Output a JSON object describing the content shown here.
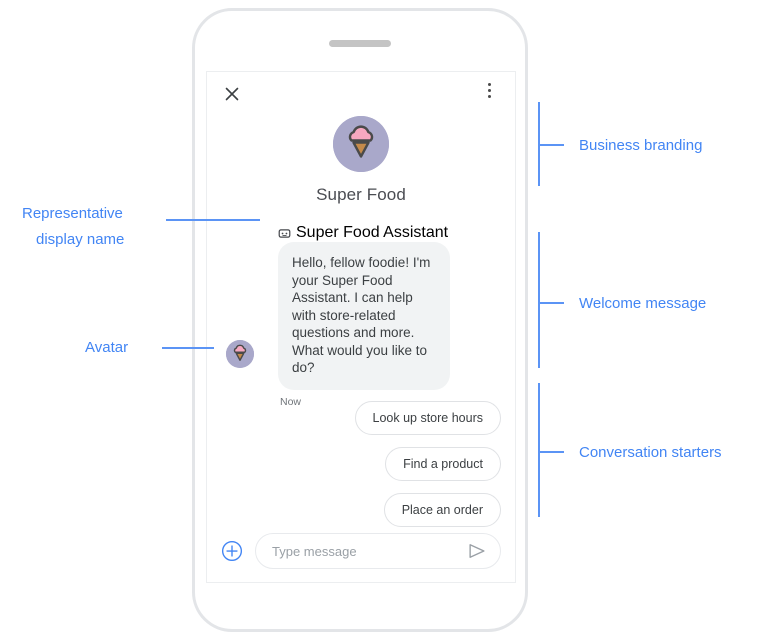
{
  "phone": {
    "speaker_grille": "speaker-grille"
  },
  "chat": {
    "topbar": {
      "close_label": "Close",
      "menu_label": "More options"
    },
    "branding": {
      "business_name": "Super Food",
      "avatar_icon": "ice-cream-cone-icon",
      "avatar_circle_color": "#a9a8ca",
      "scoop_color": "#f7a8c0",
      "cone_color": "#c58a4a",
      "outline_color": "#4a4a4a"
    },
    "representative": {
      "icon": "smart-toy-icon",
      "display_name": "Super Food Assistant"
    },
    "welcome_message": {
      "text": "Hello, fellow foodie! I'm your Super Food Assistant. I can help with store-related questions and more. What would you like to do?",
      "timestamp": "Now",
      "avatar_icon": "ice-cream-cone-icon"
    },
    "conversation_starters": [
      {
        "label": "Look up store hours"
      },
      {
        "label": "Find a product"
      },
      {
        "label": "Place an order"
      }
    ],
    "composer": {
      "add_icon": "plus-circle-icon",
      "placeholder": "Type message",
      "value": "",
      "send_icon": "send-icon"
    }
  },
  "annotations": {
    "accent_color": "#4285f4",
    "right": [
      {
        "label": "Business branding"
      },
      {
        "label": "Welcome message"
      },
      {
        "label": "Conversation starters"
      }
    ],
    "left": [
      {
        "line1": "Representative",
        "line2": "display name"
      },
      {
        "line1": "Avatar",
        "line2": ""
      }
    ]
  }
}
